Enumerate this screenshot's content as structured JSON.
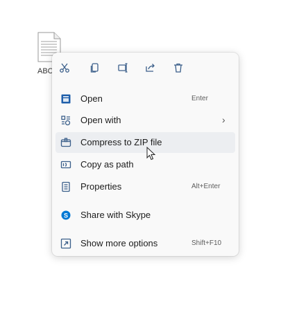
{
  "desktop": {
    "file_label": "ABC"
  },
  "toolbar": {
    "buttons": [
      {
        "name": "cut-icon"
      },
      {
        "name": "copy-icon"
      },
      {
        "name": "rename-icon"
      },
      {
        "name": "share-icon"
      },
      {
        "name": "delete-icon"
      }
    ]
  },
  "menu": {
    "items": [
      {
        "label": "Open",
        "shortcut": "Enter",
        "icon": "open-icon"
      },
      {
        "label": "Open with",
        "shortcut": "",
        "icon": "open-with-icon",
        "arrow": "›"
      },
      {
        "label": "Compress to ZIP file",
        "shortcut": "",
        "icon": "zip-icon",
        "hovered": true
      },
      {
        "label": "Copy as path",
        "shortcut": "",
        "icon": "copy-path-icon"
      },
      {
        "label": "Properties",
        "shortcut": "Alt+Enter",
        "icon": "properties-icon"
      },
      {
        "label": "Share with Skype",
        "shortcut": "",
        "icon": "skype-icon"
      },
      {
        "label": "Show more options",
        "shortcut": "Shift+F10",
        "icon": "more-options-icon"
      }
    ]
  },
  "colors": {
    "accent": "#1f5faa",
    "skype": "#0078d4",
    "hover": "#eceef1"
  }
}
